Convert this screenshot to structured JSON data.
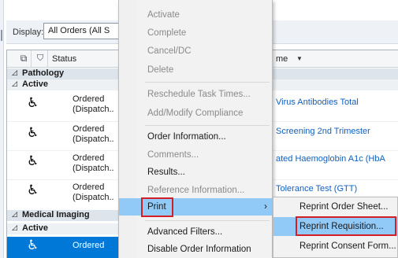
{
  "display": {
    "label": "Display:",
    "value": "All Orders (All S"
  },
  "grid": {
    "columns": {
      "status": "Status",
      "name": "me"
    },
    "groups": [
      {
        "label": "Pathology",
        "sub": "Active"
      },
      {
        "label": "Medical Imaging",
        "sub": "Active"
      }
    ],
    "rows": [
      {
        "status_line1": "Ordered",
        "status_line2": "(Dispatch..",
        "name": "Virus Antibodies Total"
      },
      {
        "status_line1": "Ordered",
        "status_line2": "(Dispatch..",
        "name": "Screening 2nd Trimester"
      },
      {
        "status_line1": "Ordered",
        "status_line2": "(Dispatch..",
        "name": "ated Haemoglobin A1c (HbA"
      },
      {
        "status_line1": "Ordered",
        "status_line2": "(Dispatch..",
        "name": "Tolerance Test (GTT)"
      },
      {
        "status_line1": "Ordered",
        "status_line2": "",
        "name": ""
      }
    ]
  },
  "context_menu": {
    "items": [
      {
        "label": "Activate",
        "enabled": false
      },
      {
        "label": "Complete",
        "enabled": false
      },
      {
        "label": "Cancel/DC",
        "enabled": false
      },
      {
        "label": "Delete",
        "enabled": false
      },
      {
        "label": "Reschedule Task Times...",
        "enabled": false
      },
      {
        "label": "Add/Modify Compliance",
        "enabled": false
      },
      {
        "label": "Order Information...",
        "enabled": true
      },
      {
        "label": "Comments...",
        "enabled": false
      },
      {
        "label": "Results...",
        "enabled": true
      },
      {
        "label": "Reference Information...",
        "enabled": false
      },
      {
        "label": "Print",
        "enabled": true,
        "has_submenu": true
      },
      {
        "label": "Advanced Filters...",
        "enabled": true
      },
      {
        "label": "Disable Order Information",
        "enabled": true
      }
    ],
    "chevron": "›"
  },
  "print_submenu": {
    "items": [
      {
        "label": "Reprint Order Sheet..."
      },
      {
        "label": "Reprint Requisition..."
      },
      {
        "label": "Reprint Consent Form..."
      }
    ]
  },
  "glyphs": {
    "collapse": "◿",
    "sort_desc": "▼",
    "wheelchair": "♿",
    "notes": "⧉",
    "filter": "⛉"
  },
  "colors": {
    "highlight": "#91c9f7",
    "selection": "#0078d7",
    "annotation": "#d21f26",
    "link": "#1060c0"
  }
}
